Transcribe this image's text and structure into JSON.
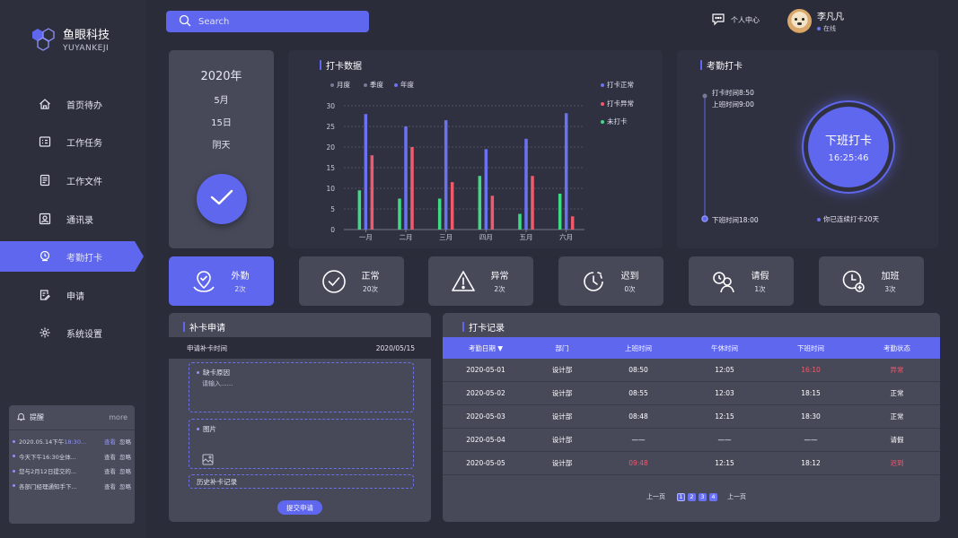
{
  "brand": {
    "name_cn": "鱼眼科技",
    "name_en": "YUYANKEJI"
  },
  "sidebar": {
    "items": [
      {
        "label": "首页待办",
        "icon": "home-icon"
      },
      {
        "label": "工作任务",
        "icon": "task-icon"
      },
      {
        "label": "工作文件",
        "icon": "file-icon"
      },
      {
        "label": "通讯录",
        "icon": "contacts-icon"
      },
      {
        "label": "考勤打卡",
        "icon": "clock-in-icon",
        "active": true
      },
      {
        "label": "申请",
        "icon": "apply-icon"
      },
      {
        "label": "系统设置",
        "icon": "gear-icon"
      }
    ]
  },
  "reminders": {
    "title": "提醒",
    "more": "more",
    "view": "查看",
    "ignore": "忽略",
    "items": [
      {
        "text_a": "2020.05.14下午",
        "text_b": "18:30..."
      },
      {
        "text_a": "今天下午16:30全体...",
        "text_b": ""
      },
      {
        "text_a": "您与2月12日提交的...",
        "text_b": ""
      },
      {
        "text_a": "各部门经理通知手下...",
        "text_b": ""
      }
    ]
  },
  "search": {
    "placeholder": "Search"
  },
  "header": {
    "personal_center": "个人中心",
    "user_name": "李凡凡",
    "user_status": "在线"
  },
  "date_card": {
    "year": "2020年",
    "month": "5月",
    "day": "15日",
    "weather": "阴天"
  },
  "chart_card": {
    "title": "打卡数据",
    "tabs": [
      "月度",
      "季度",
      "年度"
    ]
  },
  "chart_data": {
    "type": "bar",
    "title": "打卡数据",
    "categories": [
      "一月",
      "二月",
      "三月",
      "四月",
      "五月",
      "六月"
    ],
    "ylim": [
      0,
      30
    ],
    "yticks": [
      "0",
      "5",
      "10",
      "15",
      "20",
      "25",
      "30"
    ],
    "legend_position": "top-right",
    "grid": true,
    "series": [
      {
        "name": "未打卡",
        "color": "#3ddc84",
        "values": [
          9.5,
          7.5,
          7.5,
          13,
          3.8,
          8.7
        ]
      },
      {
        "name": "打卡正常",
        "color": "#6b72f2",
        "values": [
          28,
          25,
          26.5,
          19.5,
          22,
          28.2
        ]
      },
      {
        "name": "打卡异常",
        "color": "#ef5a6d",
        "values": [
          18,
          20,
          11.5,
          8.2,
          13,
          3.2
        ]
      }
    ]
  },
  "attend": {
    "title": "考勤打卡",
    "work_time": "打卡时间8:50",
    "start_time": "上班时间9:00",
    "end_time": "下班时间18:00",
    "button_title": "下班打卡",
    "button_time": "16:25:46",
    "streak": "你已连续打卡20天"
  },
  "stats": [
    {
      "name": "外勤",
      "count": "2次",
      "icon": "field-work-icon"
    },
    {
      "name": "正常",
      "count": "20次",
      "icon": "check-circle-icon"
    },
    {
      "name": "异常",
      "count": "2次",
      "icon": "warning-icon"
    },
    {
      "name": "迟到",
      "count": "0次",
      "icon": "late-clock-icon"
    },
    {
      "name": "请假",
      "count": "1次",
      "icon": "leave-user-icon"
    },
    {
      "name": "加班",
      "count": "3次",
      "icon": "overtime-clock-icon"
    }
  ],
  "apply": {
    "title": "补卡申请",
    "time_label": "申请补卡时间",
    "time_value": "2020/05/15",
    "reason_label": "缺卡原因",
    "reason_placeholder": "请输入......",
    "image_label": "图片",
    "history_label": "历史补卡记录",
    "submit": "提交申请"
  },
  "records": {
    "title": "打卡记录",
    "headers": [
      "考勤日期 ▼",
      "部门",
      "上班时间",
      "午休时间",
      "下班时间",
      "考勤状态"
    ],
    "rows": [
      {
        "date": "2020-05-01",
        "dept": "设计部",
        "on": "08:50",
        "noon": "12:05",
        "off": "16:10",
        "status": "异常",
        "off_red": true,
        "status_red": true
      },
      {
        "date": "2020-05-02",
        "dept": "设计部",
        "on": "08:55",
        "noon": "12:03",
        "off": "18:15",
        "status": "正常"
      },
      {
        "date": "2020-05-03",
        "dept": "设计部",
        "on": "08:48",
        "noon": "12:15",
        "off": "18:30",
        "status": "正常"
      },
      {
        "date": "2020-05-04",
        "dept": "设计部",
        "on": "——",
        "noon": "——",
        "off": "——",
        "status": "请假"
      },
      {
        "date": "2020-05-05",
        "dept": "设计部",
        "on": "09:48",
        "noon": "12:15",
        "off": "18:12",
        "status": "迟到",
        "on_red": true,
        "status_red": true
      }
    ],
    "pager": {
      "prev": "上一页",
      "pages": [
        "1",
        "2",
        "3",
        "4"
      ],
      "next": "上一页"
    }
  }
}
